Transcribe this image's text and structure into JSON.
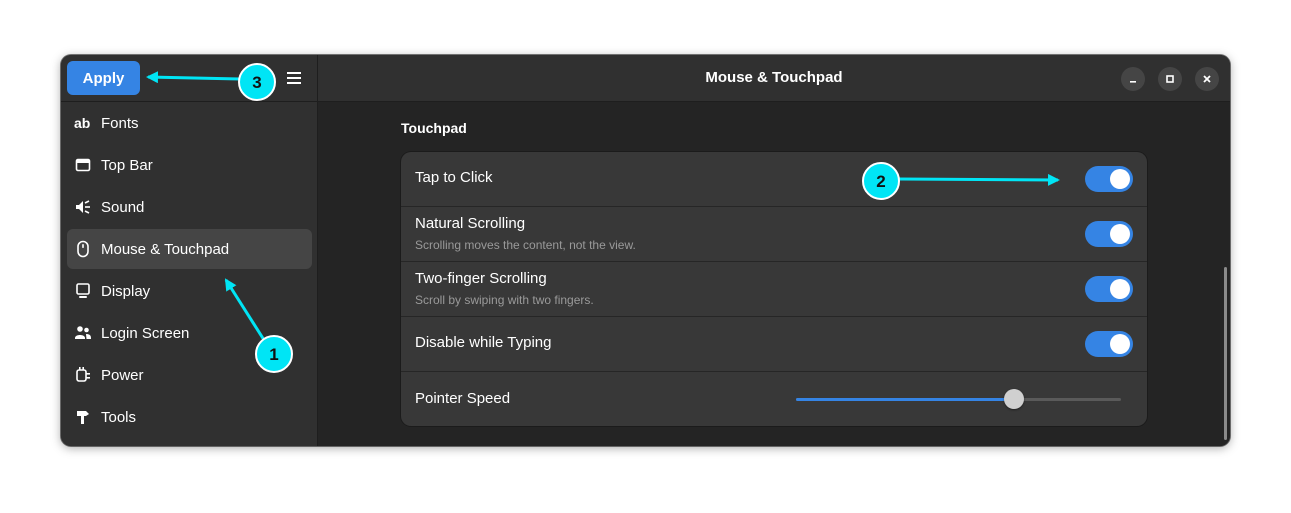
{
  "window": {
    "title": "Mouse & Touchpad"
  },
  "header": {
    "apply_label": "Apply",
    "menu_icon": "hamburger-menu-icon"
  },
  "sidebar": {
    "items": [
      {
        "label": "Fonts",
        "icon": "fonts-icon",
        "selected": false
      },
      {
        "label": "Top Bar",
        "icon": "top-bar-icon",
        "selected": false
      },
      {
        "label": "Sound",
        "icon": "sound-icon",
        "selected": false
      },
      {
        "label": "Mouse & Touchpad",
        "icon": "mouse-icon",
        "selected": true
      },
      {
        "label": "Display",
        "icon": "display-icon",
        "selected": false
      },
      {
        "label": "Login Screen",
        "icon": "users-icon",
        "selected": false
      },
      {
        "label": "Power",
        "icon": "power-plug-icon",
        "selected": false
      },
      {
        "label": "Tools",
        "icon": "tools-icon",
        "selected": false
      }
    ]
  },
  "main": {
    "section_title": "Touchpad",
    "rows": [
      {
        "label": "Tap to Click",
        "subtitle": "",
        "control": "switch",
        "value": true
      },
      {
        "label": "Natural Scrolling",
        "subtitle": "Scrolling moves the content, not the view.",
        "control": "switch",
        "value": true
      },
      {
        "label": "Two-finger Scrolling",
        "subtitle": "Scroll by swiping with two fingers.",
        "control": "switch",
        "value": true
      },
      {
        "label": "Disable while Typing",
        "subtitle": "",
        "control": "switch",
        "value": true
      },
      {
        "label": "Pointer Speed",
        "subtitle": "",
        "control": "slider",
        "value": 0.67
      }
    ]
  },
  "annotations": [
    {
      "number": "1"
    },
    {
      "number": "2"
    },
    {
      "number": "3"
    }
  ],
  "colors": {
    "accent": "#3584e4",
    "annotation": "#00e5f5",
    "sidebar_bg": "#303030",
    "content_bg": "#242424",
    "card_bg": "#383838"
  }
}
